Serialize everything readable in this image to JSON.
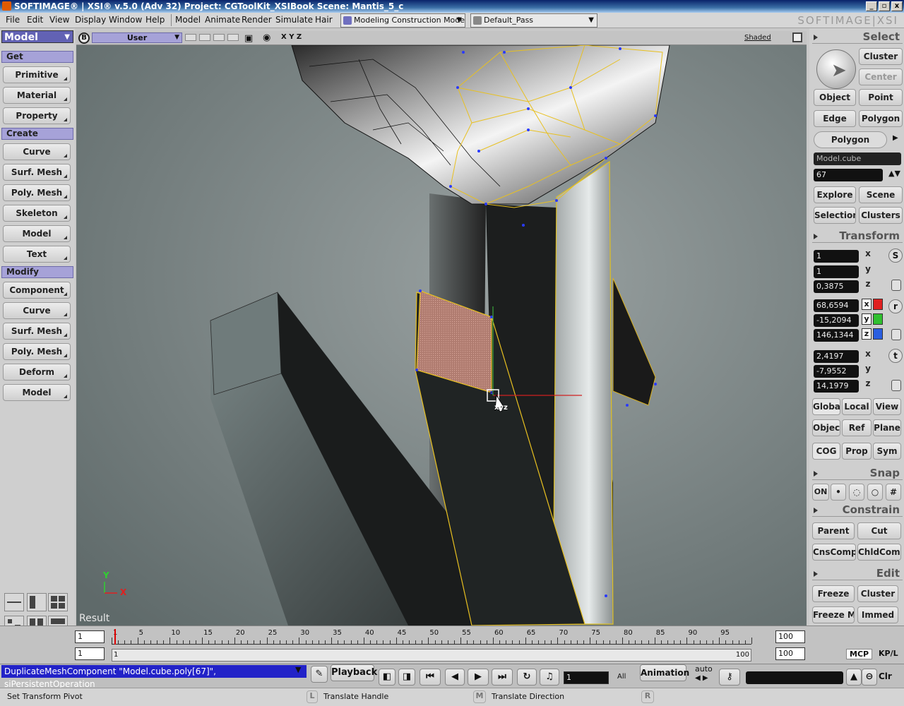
{
  "window": {
    "title": "SOFTIMAGE® | XSI® v.5.0 (Adv 32) Project: CGToolKit_XSIBook    Scene: Mantis_5_c",
    "controls": [
      "_",
      "▫",
      "x"
    ],
    "logo": "SOFTIMAGE|XSI"
  },
  "menu": {
    "items": [
      "File",
      "Edit",
      "View",
      "Display",
      "Window",
      "Help"
    ],
    "modules": [
      "Model",
      "Animate",
      "Render",
      "Simulate",
      "Hair"
    ],
    "construction_mode": "Modeling Construction Mode",
    "render_pass": "Default_Pass"
  },
  "left_panel": {
    "module_selector": "Model",
    "get": {
      "header": "Get",
      "buttons": [
        "Primitive",
        "Material",
        "Property"
      ]
    },
    "create": {
      "header": "Create",
      "buttons": [
        "Curve",
        "Surf. Mesh",
        "Poly. Mesh",
        "Skeleton",
        "Model",
        "Text"
      ]
    },
    "modify": {
      "header": "Modify",
      "buttons": [
        "Component",
        "Curve",
        "Surf. Mesh",
        "Poly. Mesh",
        "Deform",
        "Model"
      ]
    }
  },
  "viewport": {
    "badge": "B",
    "camera": "User",
    "axes_label": "X Y Z",
    "display_mode": "Shaded",
    "result_label": "Result",
    "manip_label": "xyz",
    "axis_y": "Y",
    "axis_x": "X"
  },
  "right_panel": {
    "select": {
      "header": "Select",
      "cluster": "Cluster",
      "center": "Center",
      "object": "Object",
      "point": "Point",
      "edge": "Edge",
      "polygon": "Polygon",
      "active_filter": "Polygon",
      "selection_name": "Model.cube",
      "selection_count": "67",
      "explore": "Explore",
      "scene": "Scene",
      "selection": "Selection",
      "clusters": "Clusters"
    },
    "transform": {
      "header": "Transform",
      "scale": [
        "1",
        "1",
        "0,3875"
      ],
      "rotate": [
        "68,6594",
        "-15,2094",
        "146,1344"
      ],
      "translate": [
        "2,4197",
        "-7,9552",
        "14,1979"
      ],
      "axis_labels": [
        "x",
        "y",
        "z"
      ],
      "scale_icon": "S",
      "rotate_icon": "r",
      "translate_icon": "t",
      "ref_buttons": [
        "Global",
        "Local",
        "View",
        "Object",
        "Ref",
        "Plane",
        "COG",
        "Prop",
        "Sym"
      ]
    },
    "snap": {
      "header": "Snap",
      "on": "ON"
    },
    "constrain": {
      "header": "Constrain",
      "buttons": [
        "Parent",
        "Cut",
        "CnsComp",
        "ChldComp"
      ]
    },
    "edit": {
      "header": "Edit",
      "buttons": [
        "Freeze",
        "Cluster",
        "Freeze M",
        "Immed"
      ]
    },
    "colors": {
      "x": "#e02020",
      "y": "#30c030",
      "z": "#2a5ee0",
      "accent": "#a6a2d8"
    }
  },
  "timeline": {
    "start_frame": "1",
    "end_frame": "100",
    "range_start": "1",
    "range_end": "100",
    "scrub_start": "1",
    "scrub_end": "100",
    "ruler_labels": [
      "1",
      "5",
      "10",
      "15",
      "20",
      "25",
      "30",
      "35",
      "40",
      "45",
      "50",
      "55",
      "60",
      "65",
      "70",
      "75",
      "80",
      "85",
      "90",
      "95"
    ],
    "current_frame": 1,
    "mcp": "MCP",
    "kpl": "KP/L"
  },
  "command": {
    "line": "DuplicateMeshComponent \"Model.cube.poly[67]\", siPersistentOperation",
    "playback": "Playback",
    "frame_field": "1",
    "all": "All",
    "animation": "Animation",
    "auto": "auto",
    "clr": "Clr"
  },
  "status": {
    "message": "Set Transform Pivot",
    "left_mouse": "L",
    "left_text": "Translate Handle",
    "middle_mouse": "M",
    "middle_text": "Translate Direction",
    "right_mouse": "R"
  }
}
